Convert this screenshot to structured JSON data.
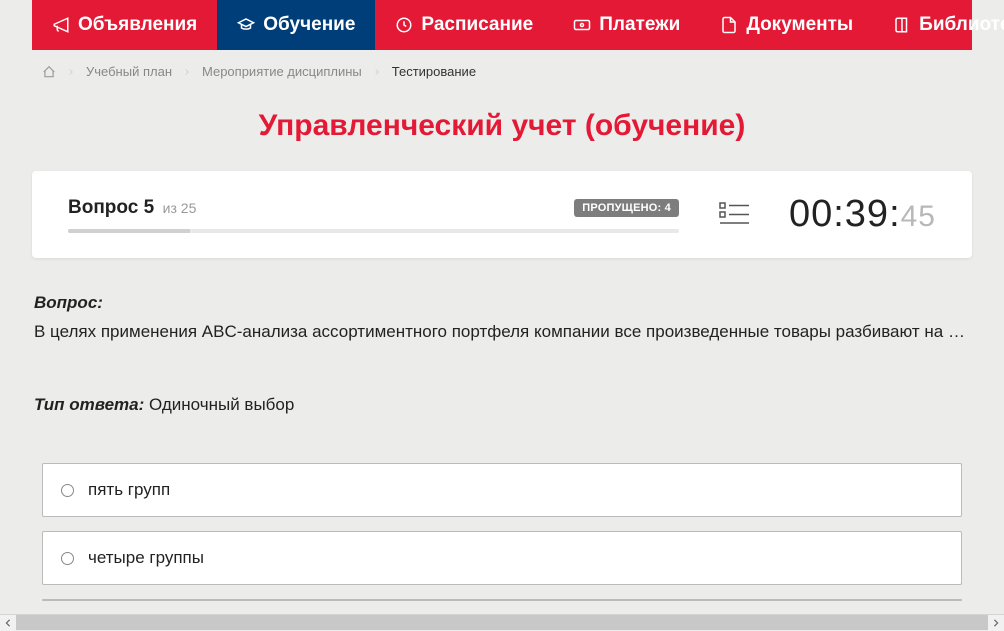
{
  "nav": {
    "items": [
      {
        "label": "Объявления",
        "icon": "megaphone"
      },
      {
        "label": "Обучение",
        "icon": "graduation",
        "active": true
      },
      {
        "label": "Расписание",
        "icon": "clock"
      },
      {
        "label": "Платежи",
        "icon": "payment"
      },
      {
        "label": "Документы",
        "icon": "document"
      },
      {
        "label": "Библиотека",
        "icon": "book",
        "dropdown": true
      }
    ]
  },
  "breadcrumb": {
    "items": [
      "Учебный план",
      "Мероприятие дисциплины",
      "Тестирование"
    ]
  },
  "title": "Управленческий учет (обучение)",
  "question_header": {
    "label": "Вопрос 5",
    "total_prefix": "из ",
    "total": "25",
    "skipped_label": "ПРОПУЩЕНО: 4",
    "progress_percent": 20
  },
  "timer": {
    "mm": "00",
    "ss": "39",
    "ms": "45"
  },
  "question": {
    "label": "Вопрос:",
    "text": "В целях применения ABC-анализа ассортиментного портфеля компании все произведенные товары разбивают на …"
  },
  "answer_type": {
    "label": "Тип ответа:",
    "value": "Одиночный выбор"
  },
  "options": [
    {
      "text": "пять групп"
    },
    {
      "text": "четыре группы"
    }
  ]
}
